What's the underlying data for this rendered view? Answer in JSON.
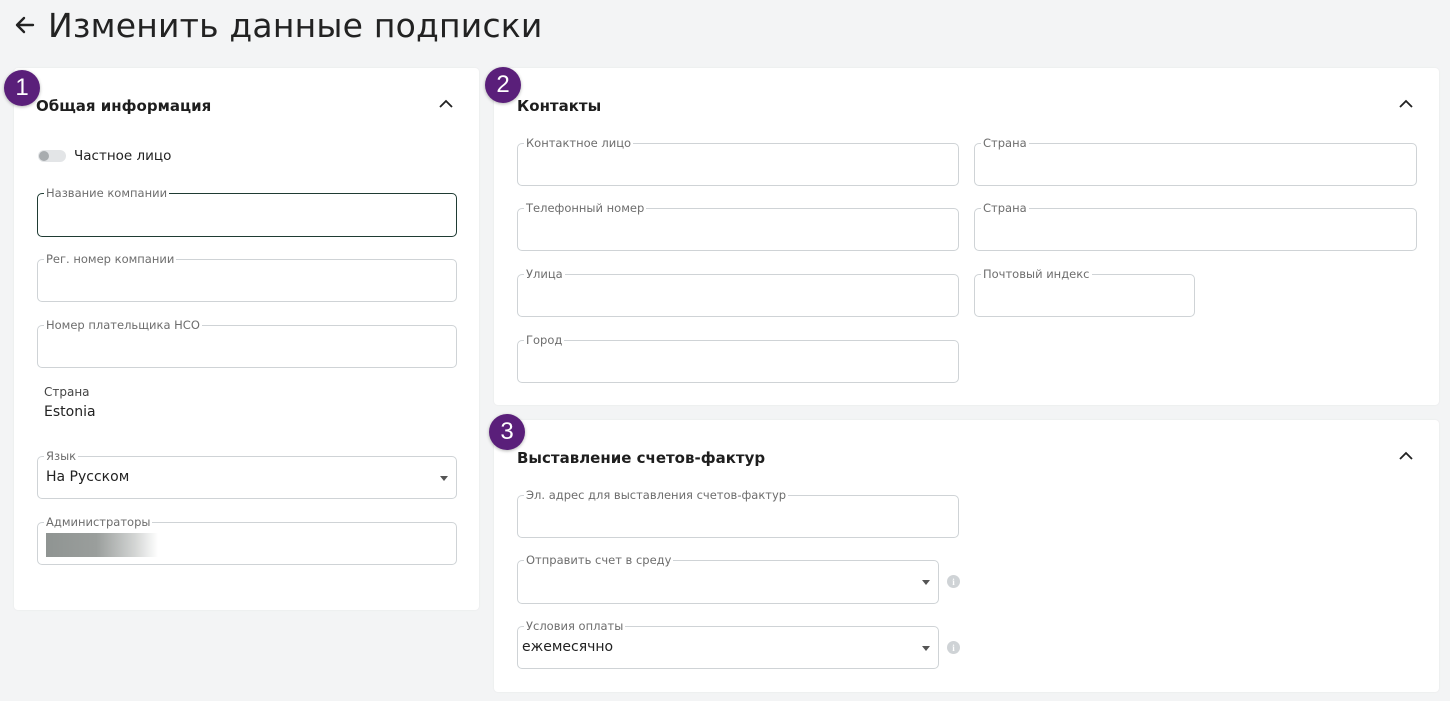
{
  "header": {
    "title": "Изменить данные подписки",
    "back_icon": "arrow-left-icon"
  },
  "colors": {
    "badge": "#5a1f7a",
    "focus_border": "#1f3b33",
    "border": "#cfd3d6",
    "background": "#f3f4f5"
  },
  "general": {
    "badge": "1",
    "title": "Общая информация",
    "private_toggle": {
      "label": "Частное лицо",
      "checked": false
    },
    "company_name": {
      "label": "Название компании",
      "value": ""
    },
    "reg_number": {
      "label": "Рег. номер компании",
      "value": ""
    },
    "vat_number": {
      "label": "Номер плательщика НСО",
      "value": ""
    },
    "country": {
      "label": "Страна",
      "value": "Estonia"
    },
    "language": {
      "label": "Язык",
      "value": "На Русском"
    },
    "admins": {
      "label": "Администраторы"
    }
  },
  "contacts": {
    "badge": "2",
    "title": "Контакты",
    "contact_person": {
      "label": "Контактное лицо",
      "value": ""
    },
    "country": {
      "label": "Страна",
      "value": ""
    },
    "phone": {
      "label": "Телефонный номер",
      "value": ""
    },
    "country2": {
      "label": "Страна",
      "value": ""
    },
    "street": {
      "label": "Улица",
      "value": ""
    },
    "postal_code": {
      "label": "Почтовый индекс",
      "value": ""
    },
    "city": {
      "label": "Город",
      "value": ""
    }
  },
  "invoicing": {
    "badge": "3",
    "title": "Выставление счетов-фактур",
    "invoice_email": {
      "label": "Эл. адрес для выставления счетов-фактур",
      "value": ""
    },
    "send_to": {
      "label": "Отправить счет в среду",
      "value": ""
    },
    "payment_terms": {
      "label": "Условия оплаты",
      "value": "ежемесячно"
    }
  }
}
